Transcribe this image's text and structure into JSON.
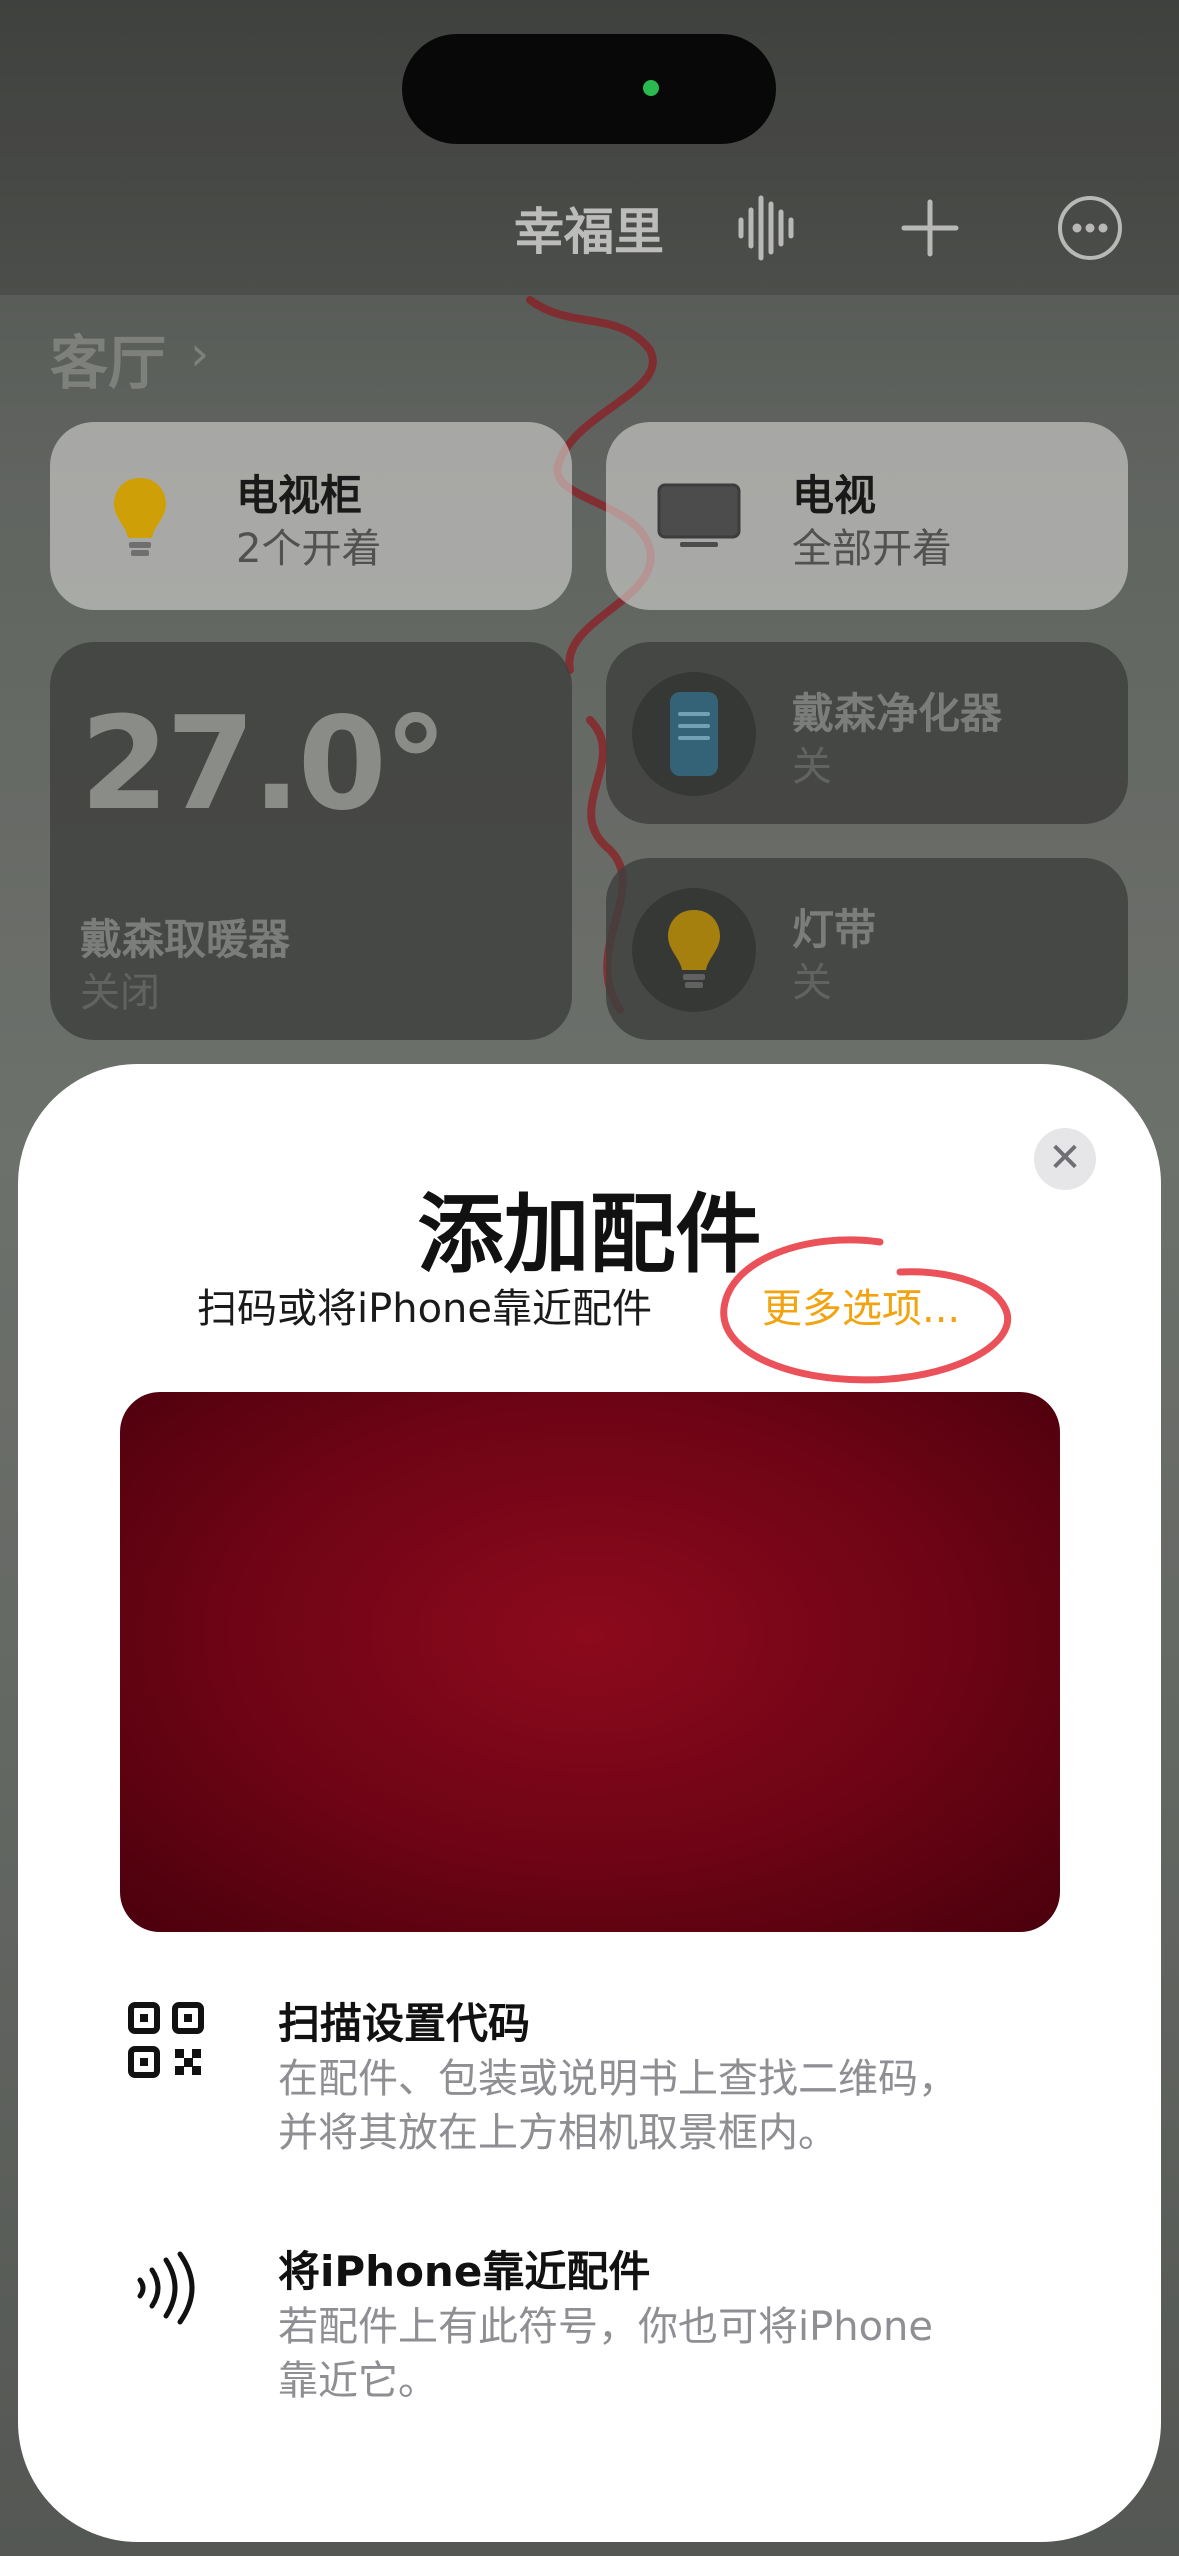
{
  "status_bar": {},
  "header": {
    "home_name": "幸福里",
    "icons": [
      "waveform-icon",
      "plus-icon",
      "more-icon"
    ]
  },
  "room": {
    "name": "客厅",
    "chevron": "›"
  },
  "tiles": {
    "tv_cabinet": {
      "name": "电视柜",
      "status": "2个开着",
      "icon": "lightbulb-icon"
    },
    "tv": {
      "name": "电视",
      "status": "全部开着",
      "icon": "tv-icon"
    },
    "heater": {
      "temperature": "27.0°",
      "name": "戴森取暖器",
      "status": "关闭"
    },
    "purifier": {
      "name": "戴森净化器",
      "status": "关",
      "icon": "air-purifier-icon"
    },
    "light_strip": {
      "name": "灯带",
      "status": "关",
      "icon": "lightbulb-icon"
    }
  },
  "sheet": {
    "title": "添加配件",
    "subtitle": "扫码或将iPhone靠近配件",
    "more_options": "更多选项...",
    "close_icon": "close-icon",
    "options": [
      {
        "icon": "qr-code-icon",
        "title": "扫描设置代码",
        "desc_line1": "在配件、包装或说明书上查找二维码，",
        "desc_line2": "并将其放在上方相机取景框内。"
      },
      {
        "icon": "nfc-icon",
        "title": "将iPhone靠近配件",
        "desc_line1": "若配件上有此符号，你也可将iPhone",
        "desc_line2": "靠近它。"
      }
    ]
  },
  "colors": {
    "accent": "#f2a30f",
    "annotation": "#e8333c",
    "camera": "#7a0a17"
  }
}
